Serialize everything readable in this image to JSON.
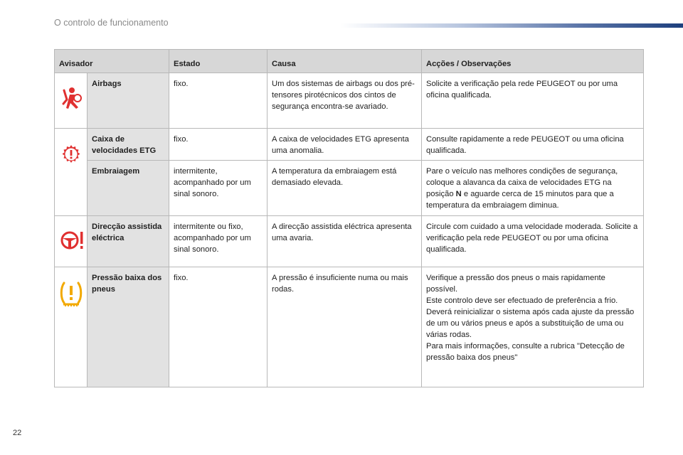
{
  "header": {
    "section_title": "O controlo de funcionamento"
  },
  "table": {
    "columns": [
      "Avisador",
      "Estado",
      "Causa",
      "Acções / Observações"
    ],
    "rows": [
      {
        "icon": "airbag-warning-icon",
        "name": "Airbags",
        "estado": "fixo.",
        "causa": "Um dos sistemas de airbags ou dos pré-tensores pirotécnicos dos cintos de segurança encontra-se avariado.",
        "acoes": "Solicite a verificação pela rede PEUGEOT ou por uma oficina qualificada."
      },
      {
        "icon": "gearbox-service-warning-icon",
        "name": "Caixa de velocidades ETG",
        "estado": "fixo.",
        "causa": "A caixa de velocidades ETG apresenta uma anomalia.",
        "acoes": "Consulte rapidamente a rede PEUGEOT ou uma oficina qualificada."
      },
      {
        "name": "Embraiagem",
        "estado": "intermitente, acompanhado por um sinal sonoro.",
        "causa": "A temperatura da embraiagem está demasiado elevada.",
        "acoes_parts": [
          "Pare o veículo nas melhores condições de segurança, coloque a alavanca da caixa de velocidades ETG na posição ",
          "N",
          " e aguarde cerca de 15 minutos para que a temperatura da embraiagem diminua."
        ]
      },
      {
        "icon": "power-steering-warning-icon",
        "name": "Direcção assistida eléctrica",
        "estado": "intermitente ou fixo, acompanhado por um sinal sonoro.",
        "causa": "A direcção assistida eléctrica apresenta uma avaria.",
        "acoes": "Circule com cuidado a uma velocidade moderada. Solicite a verificação pela rede PEUGEOT ou por uma oficina qualificada."
      },
      {
        "icon": "tyre-pressure-warning-icon",
        "name": "Pressão baixa dos pneus",
        "estado": "fixo.",
        "causa": "A pressão é insuficiente numa ou mais rodas.",
        "acoes_lines": [
          "Verifique a pressão dos pneus o mais rapidamente possível.",
          "Este controlo deve ser efectuado de preferência a frio.",
          "Deverá reinicializar o sistema após cada ajuste da pressão de um ou vários pneus e após a substituição de uma ou várias rodas.",
          "Para mais informações, consulte a rubrica \"Detecção de pressão baixa dos pneus\""
        ]
      }
    ]
  },
  "colors": {
    "airbag_icon": "#e03030",
    "gearbox_icon": "#e03030",
    "steering_icon": "#e03030",
    "tyre_icon": "#f2a900"
  },
  "footer": {
    "page_number": "22"
  }
}
